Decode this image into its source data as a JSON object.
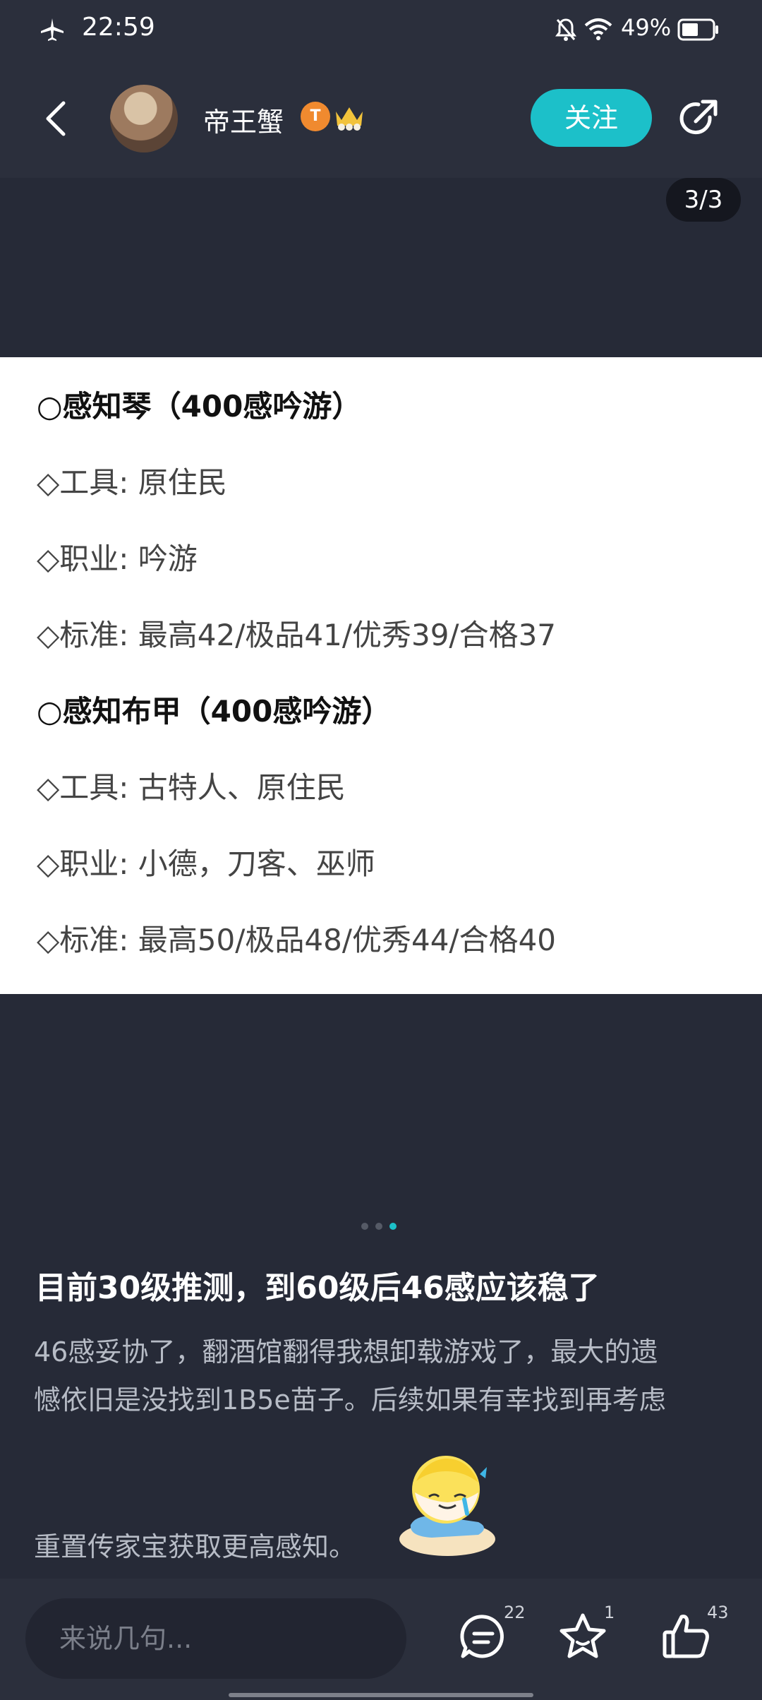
{
  "status_bar": {
    "time": "22:59",
    "battery_percent": "49%",
    "icons": [
      "airplane-icon",
      "silent-bell-icon",
      "wifi-icon",
      "battery-icon"
    ]
  },
  "header": {
    "username": "帝王蟹",
    "badge": "T",
    "follow_label": "关注",
    "icons": [
      "back-icon",
      "share-icon",
      "crown-icon"
    ]
  },
  "gallery": {
    "page_indicator": "3/3",
    "current_page": 3,
    "total_pages": 3
  },
  "image_text": {
    "lines": [
      "○感知琴（400感吟游）",
      "◇工具: 原住民",
      "◇职业: 吟游",
      "◇标准: 最高42/极品41/优秀39/合格37",
      "○感知布甲（400感吟游）",
      "◇工具: 古特人、原住民",
      "◇职业: 小德，刀客、巫师",
      "◇标准: 最高50/极品48/优秀44/合格40"
    ]
  },
  "post": {
    "title": "目前30级推测，到60级后46感应该稳了",
    "body_lines": [
      "46感妥协了，翻酒馆翻得我想卸载游戏了，最大的遗",
      "憾依旧是没找到1B5e苗子。后续如果有幸找到再考虑",
      "重置传家宝获取更高感知。"
    ]
  },
  "bottom_bar": {
    "comment_placeholder": "来说几句...",
    "comment_count": "22",
    "favorite_count": "1",
    "like_count": "43"
  },
  "colors": {
    "accent": "#1cc0c9",
    "background": "#262a37",
    "header": "#2b2f3c",
    "badge": "#f08a2f"
  }
}
